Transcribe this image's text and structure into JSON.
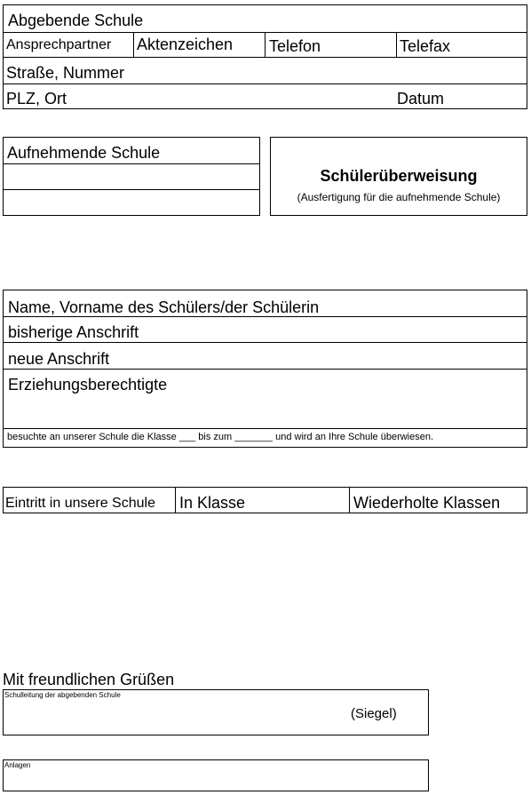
{
  "sender_block": {
    "school_label": "Abgebende Schule",
    "contact_label": "Ansprechpartner",
    "file_ref_label": "Aktenzeichen",
    "phone_label": "Telefon",
    "fax_label": "Telefax",
    "street_label": "Straße, Nummer",
    "city_label": "PLZ, Ort",
    "date_label": "Datum"
  },
  "receiver_block": {
    "school_label": "Aufnehmende Schule"
  },
  "title_box": {
    "title": "Schülerüberweisung",
    "subtitle": "(Ausfertigung für die aufnehmende Schule)"
  },
  "student_block": {
    "name_label": "Name, Vorname des Schülers/der Schülerin",
    "old_address_label": "bisherige Anschrift",
    "new_address_label": "neue Anschrift",
    "guardians_label": "Erziehungsberechtigte",
    "transfer_sentence": "besuchte an unserer Schule die Klasse ___ bis zum _______ und wird an Ihre Schule überwiesen."
  },
  "entry_block": {
    "entry_label": "Eintritt in unsere Schule",
    "class_label": "In Klasse",
    "repeated_label": "Wiederholte Klassen"
  },
  "closing": {
    "greeting": "Mit freundlichen Grüßen",
    "principal_label": "Schulleitung der abgebenden Schule",
    "seal_label": "(Siegel)",
    "attachments_label": "Anlagen"
  }
}
